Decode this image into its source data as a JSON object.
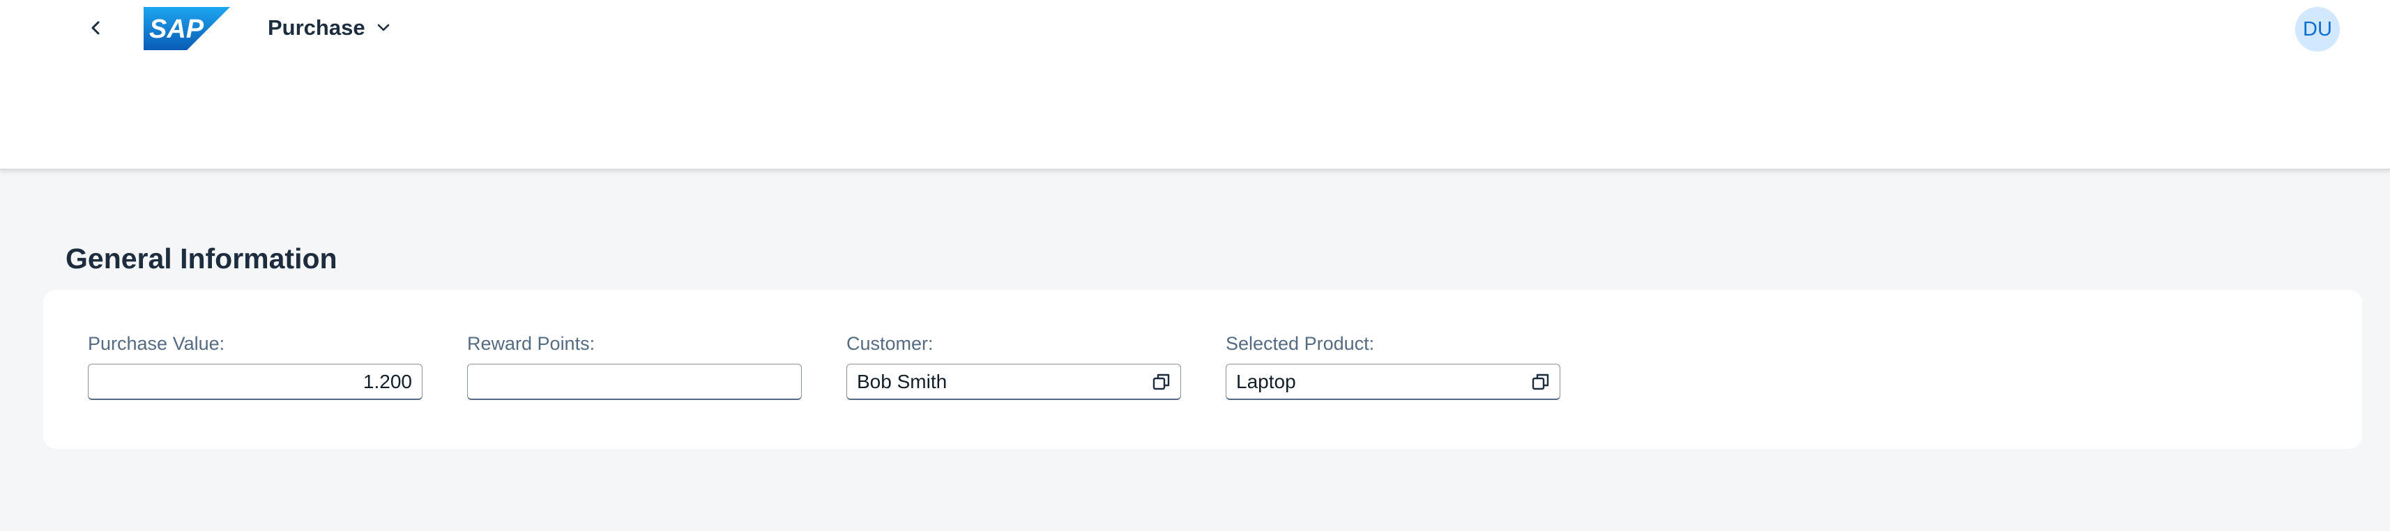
{
  "shell": {
    "app_title": "Purchase",
    "avatar_initials": "DU",
    "logo_text": "SAP",
    "colors": {
      "logo_blue": "#1c7ad1",
      "avatar_bg": "#d1e8ff",
      "avatar_text": "#0a6ed1"
    },
    "icons": {
      "back": "chevron-left-icon",
      "title_menu": "chevron-down-icon"
    }
  },
  "section": {
    "title": "General Information",
    "fields": [
      {
        "label": "Purchase Value:",
        "value": "1.200",
        "align": "right"
      },
      {
        "label": "Reward Points:",
        "value": ""
      },
      {
        "label": "Customer:",
        "value": "Bob Smith",
        "icon": "value-help-icon"
      },
      {
        "label": "Selected Product:",
        "value": "Laptop",
        "icon": "value-help-icon"
      }
    ]
  }
}
